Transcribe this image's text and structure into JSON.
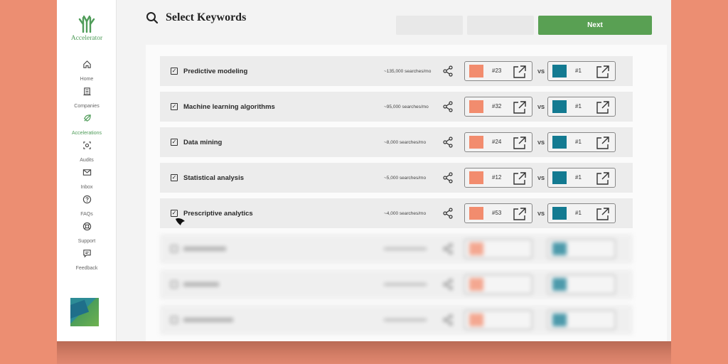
{
  "app": {
    "name": "Accelerator"
  },
  "sidebar": {
    "items": [
      {
        "label": "Home",
        "icon": "home-icon",
        "active": false
      },
      {
        "label": "Companies",
        "icon": "building-icon",
        "active": false
      },
      {
        "label": "Accelerations",
        "icon": "rocket-icon",
        "active": true
      },
      {
        "label": "Audits",
        "icon": "audit-icon",
        "active": false
      },
      {
        "label": "Inbox",
        "icon": "mail-icon",
        "active": false
      },
      {
        "label": "FAQs",
        "icon": "question-icon",
        "active": false
      },
      {
        "label": "Support",
        "icon": "lifebuoy-icon",
        "active": false
      },
      {
        "label": "Feedback",
        "icon": "chat-icon",
        "active": false
      }
    ]
  },
  "header": {
    "title": "Select Keywords",
    "next_label": "Next"
  },
  "colors": {
    "accent_green": "#59a053",
    "own_swatch": "#f28c6e",
    "competitor_swatch": "#137a91",
    "background": "#ec8e72"
  },
  "labels": {
    "vs": "VS"
  },
  "keywords": [
    {
      "keyword": "Predictive modeling",
      "volume": "~135,000 searches/mo",
      "rank": "#23",
      "competitor_rank": "#1",
      "checked": true
    },
    {
      "keyword": "Machine learning algorithms",
      "volume": "~95,000 searches/mo",
      "rank": "#32",
      "competitor_rank": "#1",
      "checked": true
    },
    {
      "keyword": "Data mining",
      "volume": "~8,000 searches/mo",
      "rank": "#24",
      "competitor_rank": "#1",
      "checked": true
    },
    {
      "keyword": "Statistical analysis",
      "volume": "~5,000 searches/mo",
      "rank": "#12",
      "competitor_rank": "#1",
      "checked": true
    },
    {
      "keyword": "Prescriptive analytics",
      "volume": "~4,000 searches/mo",
      "rank": "#53",
      "competitor_rank": "#1",
      "checked": true
    }
  ]
}
